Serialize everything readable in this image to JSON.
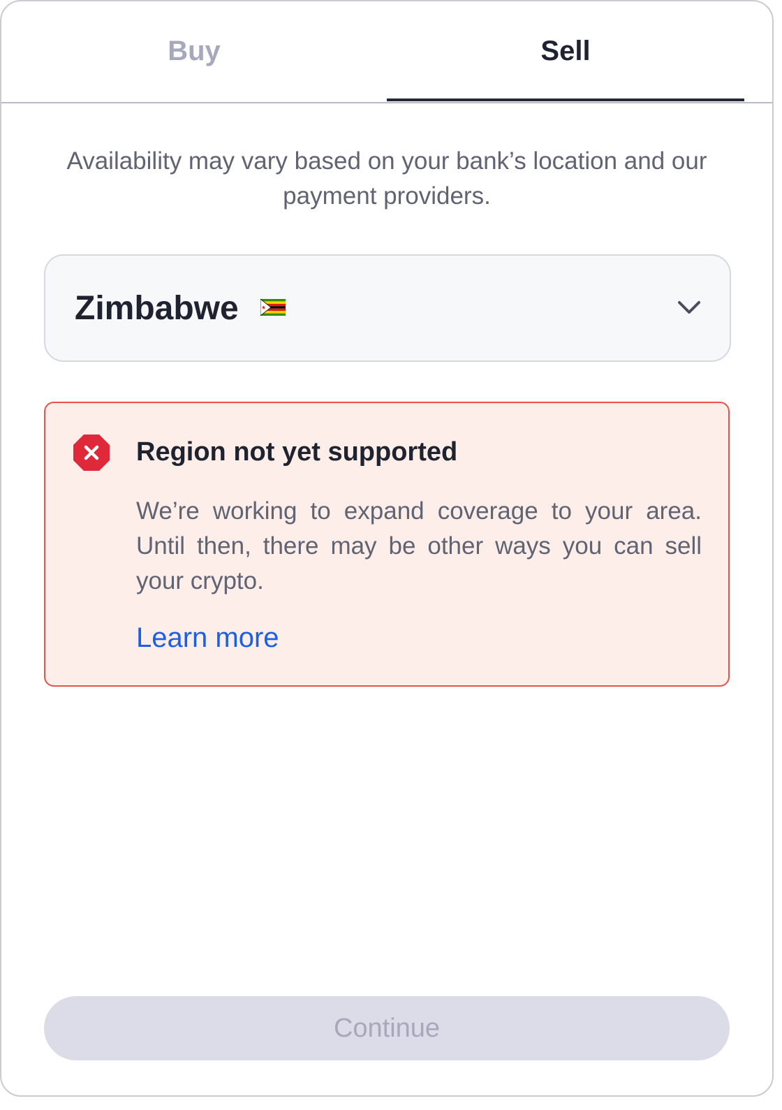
{
  "tabs": {
    "buy_label": "Buy",
    "sell_label": "Sell",
    "active": "Sell"
  },
  "notice": "Availability may vary based on your bank’s location and our payment providers.",
  "country_select": {
    "value": "Zimbabwe",
    "flag": "zimbabwe-flag-icon",
    "toggle_icon": "chevron-down-icon"
  },
  "alert": {
    "icon": "error-octagon-icon",
    "title": "Region not yet supported",
    "body": "We’re working to expand coverage to your area. Until then, there may be other ways you can sell your crypto.",
    "link_label": "Learn more"
  },
  "continue_label": "Continue",
  "colors": {
    "error": "#e0283b",
    "error_border": "#ea5248",
    "error_bg": "#fdeeea",
    "link": "#1a5fe6",
    "disabled_bg": "#dbdce7",
    "text_primary": "#1f2330",
    "text_secondary": "#5f6372"
  }
}
